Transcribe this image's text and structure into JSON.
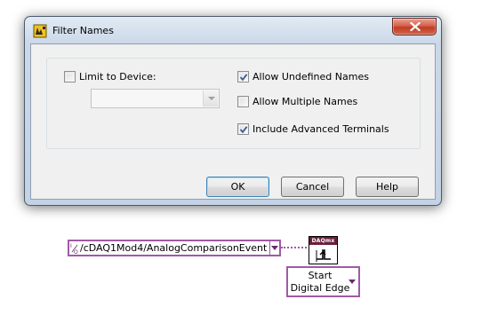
{
  "dialog": {
    "title": "Filter Names",
    "limit_to_device": {
      "label": "Limit to Device:",
      "checked": false
    },
    "device_select": {
      "value": ""
    },
    "allow_undefined_names": {
      "label": "Allow Undefined Names",
      "checked": true
    },
    "allow_multiple_names": {
      "label": "Allow Multiple Names",
      "checked": false
    },
    "include_advanced_terminals": {
      "label": "Include Advanced Terminals",
      "checked": true
    },
    "buttons": {
      "ok": "OK",
      "cancel": "Cancel",
      "help": "Help"
    }
  },
  "block_diagram": {
    "terminal_constant": {
      "icon": "I/O",
      "value": "/cDAQ1Mod4/AnalogComparisonEvent"
    },
    "vi_icon": {
      "header": "DAQmx",
      "icon": "start-trigger-digital-edge-icon"
    },
    "polymorphic_selector": {
      "line1": "Start",
      "line2": "Digital Edge"
    },
    "colors": {
      "wire": "#a05aa6",
      "vi_header": "#6a1f3c"
    }
  }
}
